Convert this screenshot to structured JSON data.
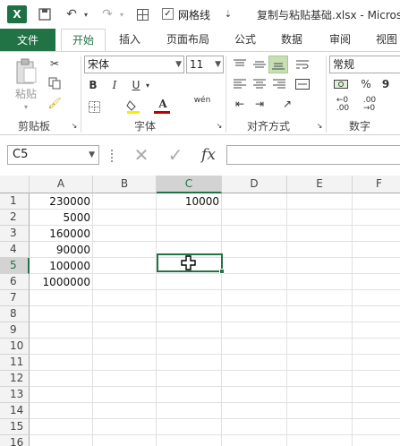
{
  "title": "复制与粘贴基础.xlsx - Micros",
  "quick_access": {
    "gridline_label": "网格线",
    "gridline_checked": "✓"
  },
  "tabs": [
    "文件",
    "开始",
    "插入",
    "页面布局",
    "公式",
    "数据",
    "审阅",
    "视图"
  ],
  "ribbon": {
    "clipboard": {
      "paste_label": "粘贴",
      "group_label": "剪贴板"
    },
    "font": {
      "font_name": "宋体",
      "font_size": "11",
      "bold": "B",
      "italic": "I",
      "underline": "U",
      "font_color_letter": "A",
      "pinyin": "wén",
      "group_label": "字体"
    },
    "alignment": {
      "group_label": "对齐方式"
    },
    "number": {
      "format": "常规",
      "percent": "%",
      "comma": "9",
      "group_label": "数字"
    }
  },
  "formula_bar": {
    "name_box": "C5",
    "fx": "fx"
  },
  "sheet": {
    "columns": [
      "A",
      "B",
      "C",
      "D",
      "E",
      "F"
    ],
    "rows": [
      "1",
      "2",
      "3",
      "4",
      "5",
      "6",
      "7",
      "8",
      "9",
      "10",
      "11",
      "12",
      "13",
      "14",
      "15",
      "16"
    ],
    "active_cell": "C5",
    "col_a": [
      "230000",
      "5000",
      "160000",
      "90000",
      "100000",
      "1000000"
    ],
    "c1": "10000"
  },
  "colors": {
    "accent": "#217346"
  }
}
